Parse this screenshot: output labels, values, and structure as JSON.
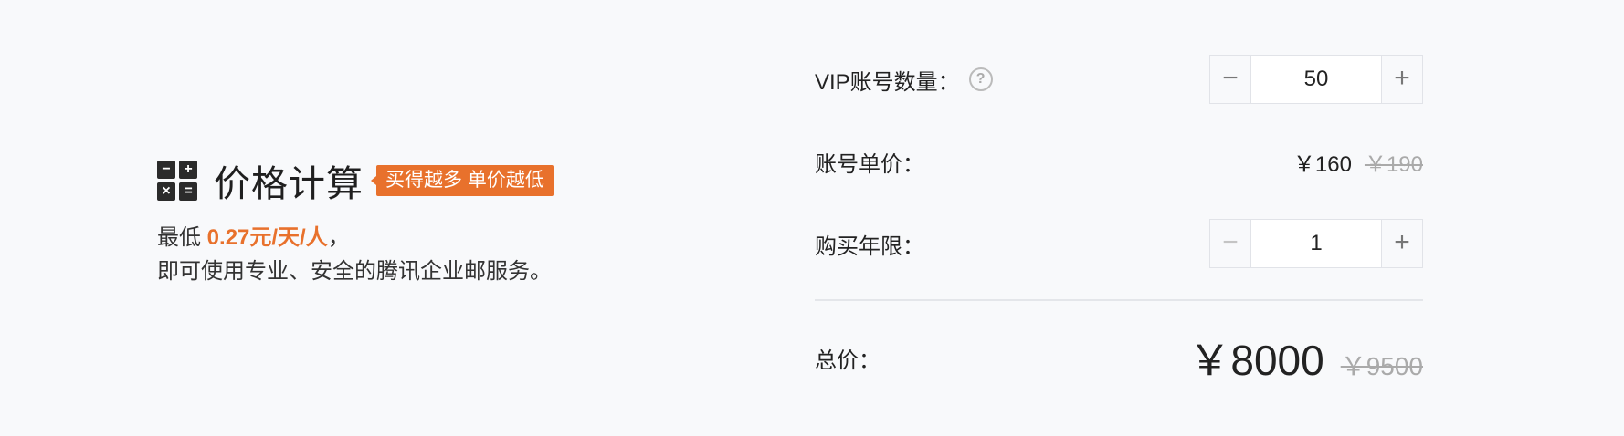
{
  "promo": {
    "icon_cells": [
      "−",
      "+",
      "×",
      "="
    ],
    "title": "价格计算",
    "tag": "买得越多 单价越低",
    "desc_prefix": "最低 ",
    "desc_highlight": "0.27元/天/人",
    "desc_suffix": "，",
    "desc_line2": "即可使用专业、安全的腾讯企业邮服务。"
  },
  "calculator": {
    "vip_count": {
      "label": "VIP账号数量：",
      "help_glyph": "?",
      "minus": "−",
      "plus": "+",
      "value": "50"
    },
    "unit_price": {
      "label": "账号单价：",
      "current": "￥160",
      "original": "￥190"
    },
    "years": {
      "label": "购买年限：",
      "minus": "−",
      "plus": "+",
      "value": "1",
      "minus_disabled": true
    },
    "total": {
      "label": "总价：",
      "current": "￥8000",
      "original": "￥9500"
    }
  },
  "colors": {
    "accent": "#e8712c",
    "background": "#f8f9fb",
    "strikethrough": "#aaaaaa"
  }
}
